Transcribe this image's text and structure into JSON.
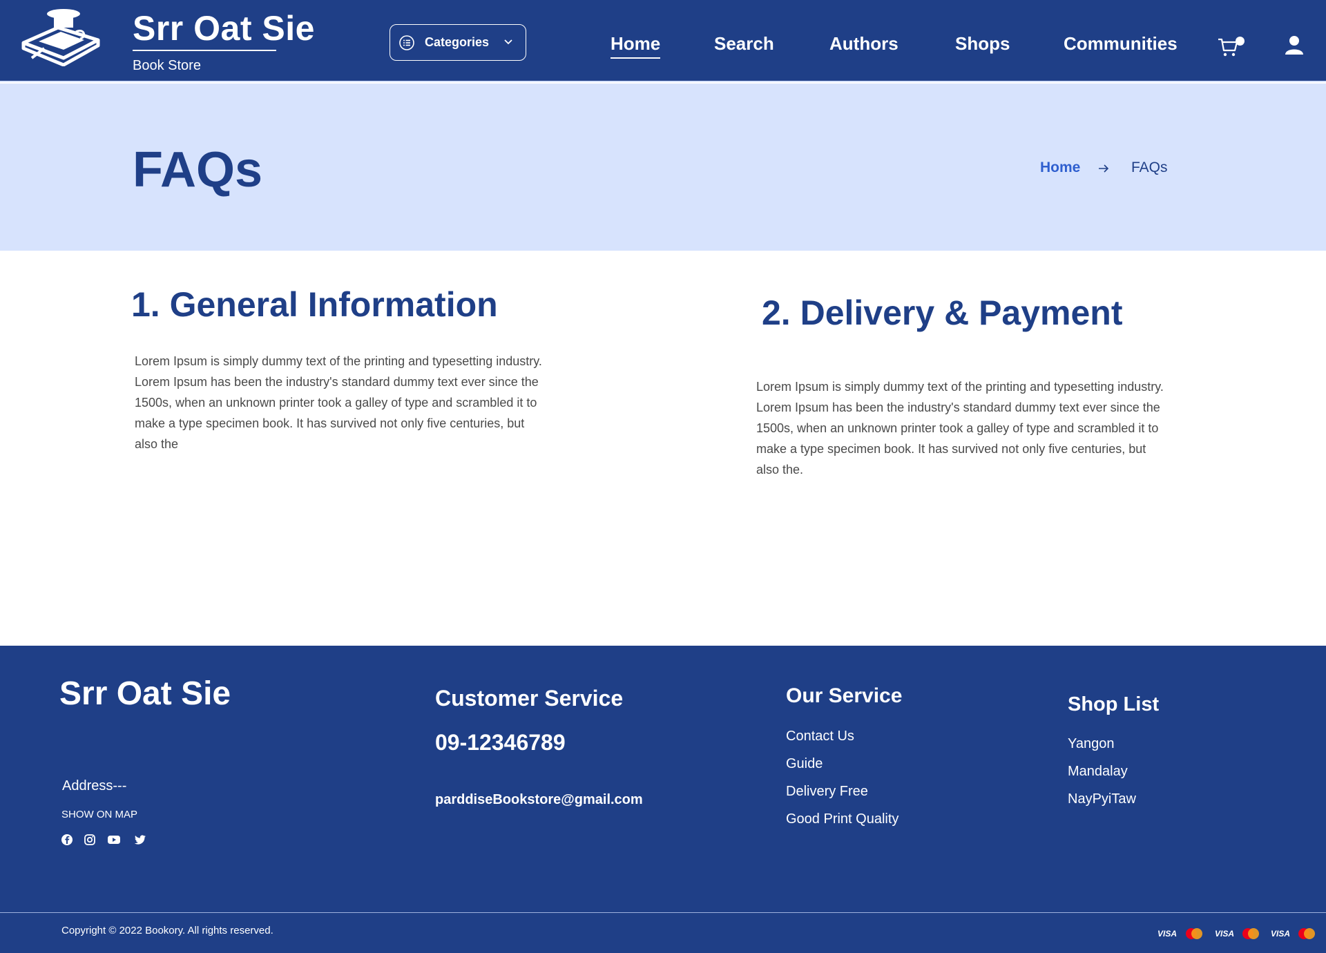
{
  "header": {
    "brand_title": "Srr Oat Sie",
    "brand_subtitle": "Book Store",
    "categories_label": "Categories",
    "nav": [
      {
        "label": "Home",
        "active": true
      },
      {
        "label": "Search"
      },
      {
        "label": "Authors"
      },
      {
        "label": "Shops"
      },
      {
        "label": "Communities"
      }
    ],
    "icons": [
      "book-logo-icon",
      "list-icon",
      "chevron-down-icon",
      "cart-icon",
      "user-icon"
    ]
  },
  "hero": {
    "title": "FAQs",
    "breadcrumb": {
      "home": "Home",
      "current": "FAQs"
    }
  },
  "sections": [
    {
      "number": "1.",
      "title": "General Information",
      "body": "Lorem Ipsum is simply dummy text of the printing and typesetting industry. Lorem Ipsum has been the industry's standard dummy text ever since the 1500s, when an unknown printer took a galley of type and scrambled it to make a type specimen book. It has survived not only five centuries, but also the"
    },
    {
      "number": "2.",
      "title": "Delivery & Payment",
      "body": "Lorem Ipsum is simply dummy text of the printing and typesetting industry. Lorem Ipsum has been the industry's standard dummy text ever since the 1500s, when an unknown printer took a galley of type and scrambled it to make a type specimen book. It has survived not only five centuries, but also the."
    }
  ],
  "footer": {
    "brand": "Srr Oat Sie",
    "address": "Address---",
    "show_on_map": "SHOW ON MAP",
    "social": [
      "facebook-icon",
      "instagram-icon",
      "youtube-icon",
      "twitter-icon"
    ],
    "customer_service": {
      "heading": "Customer Service",
      "phone": "09-12346789",
      "email": "parddiseBookstore@gmail.com"
    },
    "our_service": {
      "heading": "Our Service",
      "links": [
        "Contact Us",
        "Guide",
        "Delivery Free",
        "Good Print Quality"
      ]
    },
    "shop_list": {
      "heading": "Shop List",
      "links": [
        "Yangon",
        "Mandalay",
        "NayPyiTaw"
      ]
    },
    "copyright": "Copyright © 2022 Bookory. All rights reserved.",
    "payments": [
      "VISA",
      "MasterCard",
      "VISA",
      "MasterCard",
      "VISA",
      "MasterCard"
    ]
  },
  "colors": {
    "primary": "#1f3f87",
    "hero_bg": "#d7e3fd",
    "breadcrumb_link": "#2f5fcf",
    "body_text": "#4a4a4a"
  }
}
